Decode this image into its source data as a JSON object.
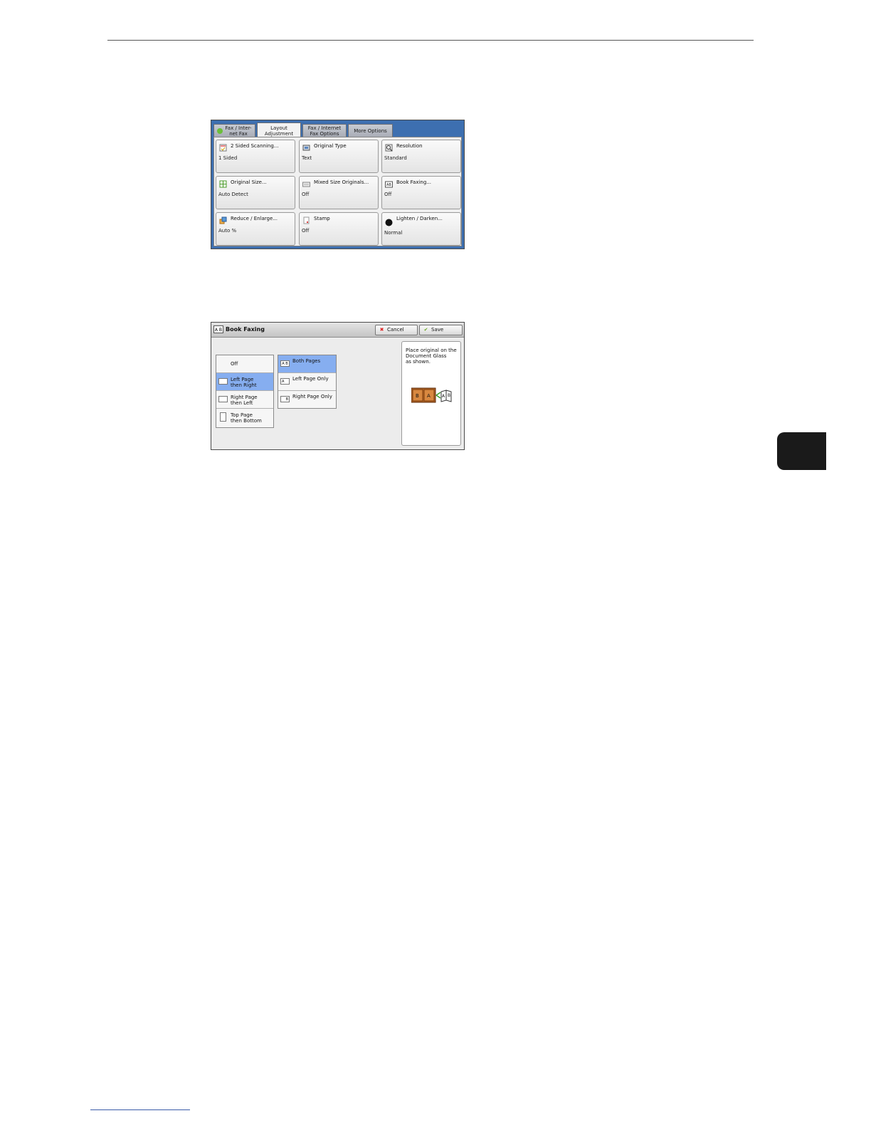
{
  "panel1": {
    "tabs": [
      {
        "label": "Fax / Inter-\nnet Fax",
        "active": false,
        "icon": "fax-icon"
      },
      {
        "label": "Layout\nAdjustment",
        "active": true
      },
      {
        "label": "Fax / Internet\nFax Options",
        "active": false
      },
      {
        "label": "More Options",
        "active": false
      }
    ],
    "features": [
      {
        "label": "2 Sided Scanning...",
        "value": "1 Sided",
        "icon": "two-sided-icon"
      },
      {
        "label": "Original Type",
        "value": "Text",
        "icon": "original-type-icon"
      },
      {
        "label": "Resolution",
        "value": "Standard",
        "icon": "resolution-icon"
      },
      {
        "label": "Original Size...",
        "value": "Auto Detect",
        "icon": "original-size-icon"
      },
      {
        "label": "Mixed Size Originals...",
        "value": "Off",
        "icon": "mixed-size-icon"
      },
      {
        "label": "Book Faxing...",
        "value": "Off",
        "icon": "book-faxing-icon"
      },
      {
        "label": "Reduce / Enlarge...",
        "value": "Auto %",
        "icon": "reduce-enlarge-icon"
      },
      {
        "label": "Stamp",
        "value": "Off",
        "icon": "stamp-icon"
      },
      {
        "label": "Lighten / Darken...",
        "value": "Normal",
        "icon": "lighten-darken-icon"
      }
    ]
  },
  "panel2": {
    "title": "Book Faxing",
    "title_icon_text": "A B",
    "cancel_label": "Cancel",
    "save_label": "Save",
    "left_options": [
      {
        "label": "Off",
        "selected": false
      },
      {
        "label": "Left Page\nthen Right",
        "selected": true
      },
      {
        "label": "Right Page\nthen Left",
        "selected": false
      },
      {
        "label": "Top Page\nthen Bottom",
        "selected": false
      }
    ],
    "right_options": [
      {
        "label": "Both Pages",
        "selected": true,
        "icon_text": "A B"
      },
      {
        "label": "Left Page Only",
        "selected": false,
        "icon_text": "A"
      },
      {
        "label": "Right Page Only",
        "selected": false,
        "icon_text": "B"
      }
    ],
    "info_text": "Place original on the\nDocument Glass\nas shown.",
    "illustration_letters": [
      "B",
      "A",
      "A",
      "B"
    ]
  },
  "colors": {
    "tab_bar": "#3d6fb0",
    "selected_option": "#86aef0",
    "chapter_tab": "#1a1a1a"
  }
}
